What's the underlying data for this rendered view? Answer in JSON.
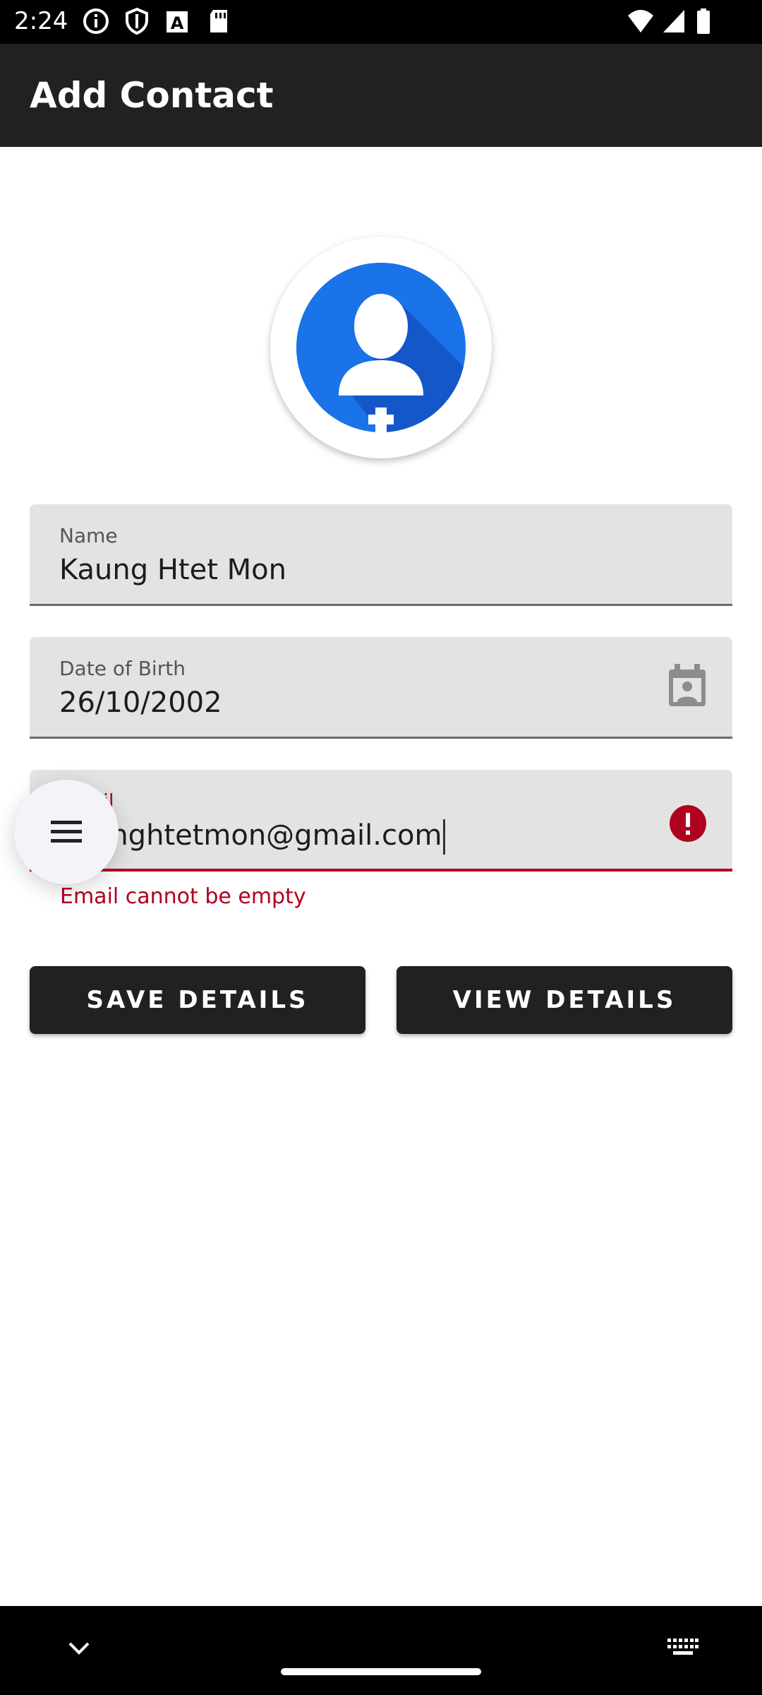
{
  "status_bar": {
    "time": "2:24",
    "left_icons": [
      "info-icon",
      "shield-icon",
      "a-badge-icon",
      "sd-card-icon"
    ],
    "right_icons": [
      "wifi-icon",
      "signal-icon",
      "battery-icon"
    ]
  },
  "app_bar": {
    "title": "Add Contact"
  },
  "avatar": {
    "icon": "add-person-icon",
    "accent": "#1a73e8"
  },
  "form": {
    "name": {
      "label": "Name",
      "value": "Kaung Htet Mon"
    },
    "dob": {
      "label": "Date of Birth",
      "value": "26/10/2002",
      "icon": "calendar-icon"
    },
    "email": {
      "label": "Email",
      "value": "kaunghtetmon@gmail.com",
      "error": "Email cannot be empty",
      "error_color": "#b00020",
      "icon": "error-icon"
    }
  },
  "buttons": {
    "save": "SAVE DETAILS",
    "view": "VIEW DETAILS"
  },
  "fab": {
    "icon": "menu-icon"
  },
  "nav_bar": {
    "left_icon": "chevron-down-icon",
    "right_icon": "keyboard-icon"
  }
}
